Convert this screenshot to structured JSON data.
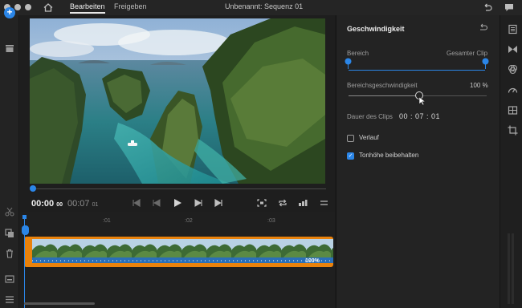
{
  "topbar": {
    "tabs": [
      "Bearbeiten",
      "Freigeben"
    ],
    "title": "Unbenannt: Sequenz 01",
    "icons": [
      "home-icon",
      "undo-icon",
      "chat-icon"
    ]
  },
  "left_toolbar": {
    "add_label": "+",
    "icons": [
      "add-icon",
      "media-bin-icon",
      "scissors-icon",
      "duplicate-icon",
      "trash-icon",
      "captions-icon",
      "list-icon"
    ]
  },
  "monitor": {
    "timecode_current": "00:00",
    "timecode_current_frames": "00",
    "timecode_duration": "00:07",
    "timecode_duration_frames": "01",
    "playback_position": 0.0,
    "controls": [
      "go-to-start-icon",
      "step-back-icon",
      "play-icon",
      "step-forward-icon",
      "go-to-end-icon",
      "fit-icon",
      "loop-icon",
      "volume-icon",
      "menu-icon"
    ]
  },
  "timeline": {
    "ruler": [
      ":01",
      ":02",
      ":03"
    ],
    "clip_speed_label": "100%"
  },
  "panel": {
    "title": "Geschwindigkeit",
    "range_label": "Bereich",
    "range_right_label": "Gesamter Clip",
    "speed_label": "Bereichsgeschwindigkeit",
    "speed_value": "100 %",
    "speed_slider_fraction": 0.5,
    "duration_label": "Dauer des Clips",
    "duration_value": "00 : 07 : 01",
    "checkbox_reverse": {
      "label": "Verlauf",
      "checked": false
    },
    "checkbox_pitch": {
      "label": "Tonhöhe beibehalten",
      "checked": true
    }
  },
  "rail": {
    "icons": [
      "properties-icon",
      "transitions-icon",
      "effects-icon",
      "speed-icon",
      "crop-icon",
      "transform-icon"
    ]
  },
  "colors": {
    "accent": "#2b86e8",
    "clip": "#e9820c",
    "background": "#1b1b1b"
  }
}
